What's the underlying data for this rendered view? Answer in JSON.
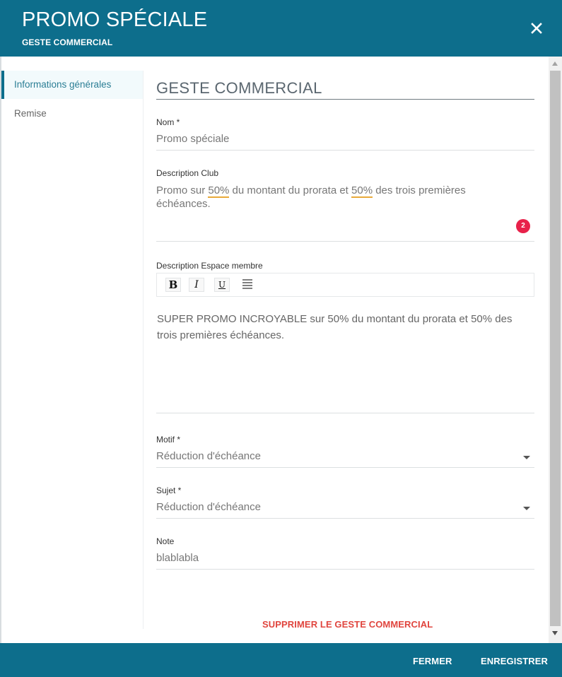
{
  "header": {
    "title": "PROMO SPÉCIALE",
    "subtitle": "GESTE COMMERCIAL",
    "close_icon": "close-icon"
  },
  "sidebar": {
    "items": [
      {
        "label": "Informations générales",
        "active": true
      },
      {
        "label": "Remise",
        "active": false
      }
    ]
  },
  "form": {
    "section_title": "GESTE COMMERCIAL",
    "nom": {
      "label": "Nom *",
      "value": "Promo spéciale"
    },
    "description_club": {
      "label": "Description Club",
      "parts": [
        "Promo sur ",
        "50%",
        " du montant du prorata et ",
        "50%",
        " des trois premières échéances."
      ],
      "spellcheck_badge": "2"
    },
    "description_espace_membre": {
      "label": "Description Espace membre",
      "toolbar": {
        "bold": "B",
        "italic": "I",
        "underline": "U",
        "align_icon": "align-justify-icon"
      },
      "text": "SUPER PROMO INCROYABLE sur 50% du montant du prorata et 50% des trois premières échéances."
    },
    "motif": {
      "label": "Motif *",
      "value": "Réduction d'échéance"
    },
    "sujet": {
      "label": "Sujet *",
      "value": "Réduction d'échéance"
    },
    "note": {
      "label": "Note",
      "value": "blablabla"
    },
    "delete_label": "SUPPRIMER LE GESTE COMMERCIAL"
  },
  "footer": {
    "close_label": "FERMER",
    "save_label": "ENREGISTRER"
  },
  "colors": {
    "brand": "#0d6e8c",
    "danger": "#e0453e",
    "badge": "#e8214a",
    "spellcheck": "#e8a93a"
  }
}
